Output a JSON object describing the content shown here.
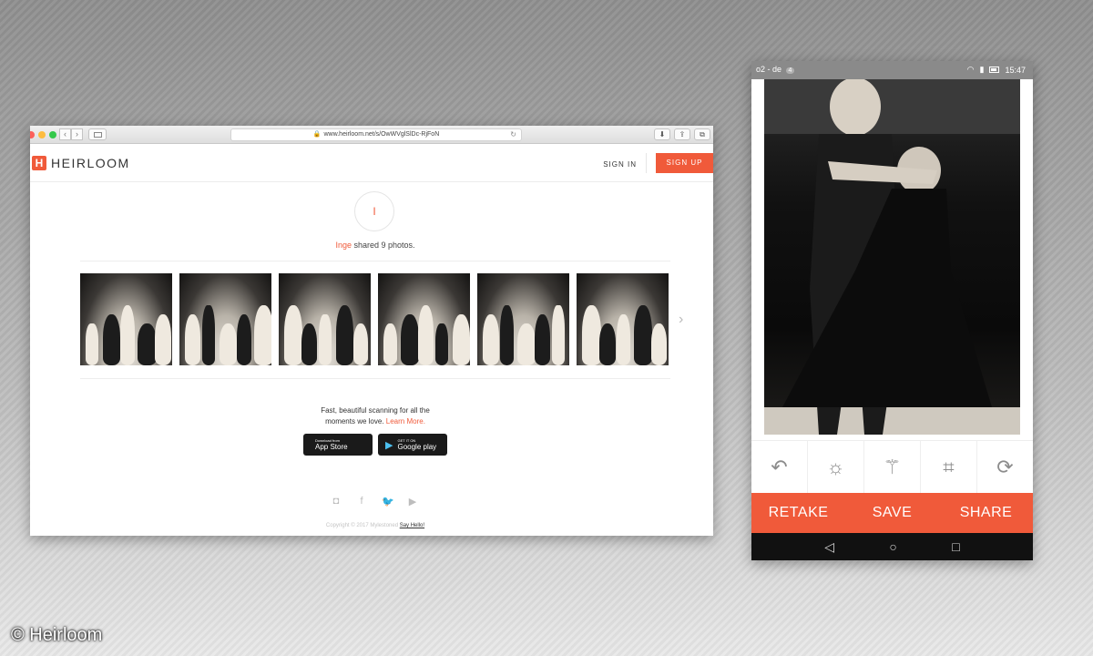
{
  "colors": {
    "brand": "#f05a3a",
    "dark": "#1a1a1a"
  },
  "browser": {
    "url": "www.heirloom.net/s/OwWVglSlDc-RjFoN",
    "logo_letter": "H",
    "logo_text": "HEIRLOOM",
    "sign_in": "SIGN IN",
    "sign_up": "SIGN UP",
    "avatar_initial": "I",
    "share_name": "Inge",
    "share_text": " shared 9 photos.",
    "photos": [
      "photo-1",
      "photo-2",
      "photo-3",
      "photo-4",
      "photo-5",
      "photo-6"
    ],
    "tagline_line1": "Fast, beautiful scanning for all the",
    "tagline_line2": "moments we love. ",
    "learn_more": "Learn More.",
    "appstore_small": "Download from",
    "appstore_big": "App Store",
    "googleplay_small": "GET IT ON",
    "googleplay_big": "Google play",
    "social": [
      "instagram-icon",
      "facebook-icon",
      "twitter-icon",
      "youtube-icon"
    ],
    "copyright": "Copyright © 2017 Mylestoned ",
    "say_hello": "Say Hello!"
  },
  "phone": {
    "carrier": "o2 - de",
    "carrier_badge": "4",
    "time": "15:47",
    "tools": [
      "undo-icon",
      "brightness-icon",
      "magic-wand-icon",
      "crop-icon",
      "rotate-icon"
    ],
    "retake": "RETAKE",
    "save": "SAVE",
    "share": "SHARE"
  },
  "credit": "© Heirloom"
}
